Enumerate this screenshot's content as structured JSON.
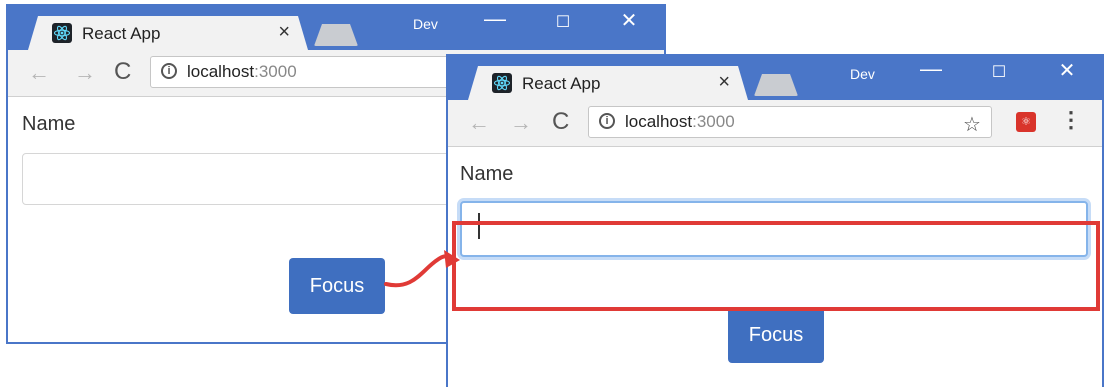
{
  "left_window": {
    "tab_title": "React App",
    "tab_close": "×",
    "profile_label": "Dev",
    "controls": {
      "minimize": "—",
      "maximize": "☐",
      "close": "✕"
    },
    "nav": {
      "back": "←",
      "forward": "→",
      "reload": "C"
    },
    "url_host": "localhost",
    "url_port": ":3000",
    "info_icon": "i",
    "name_label": "Name",
    "name_value": "",
    "focus_button": "Focus"
  },
  "right_window": {
    "tab_title": "React App",
    "tab_close": "×",
    "profile_label": "Dev",
    "controls": {
      "minimize": "—",
      "maximize": "☐",
      "close": "✕"
    },
    "nav": {
      "back": "←",
      "forward": "→",
      "reload": "C"
    },
    "url_host": "localhost",
    "url_port": ":3000",
    "info_icon": "i",
    "bookmark_star": "☆",
    "menu": "⋮",
    "name_label": "Name",
    "name_value": "",
    "focus_button": "Focus"
  },
  "colors": {
    "titlebar": "#4a76c8",
    "button": "#3f6fc0",
    "highlight": "#e03a36",
    "focus_ring": "#85b4ea"
  }
}
